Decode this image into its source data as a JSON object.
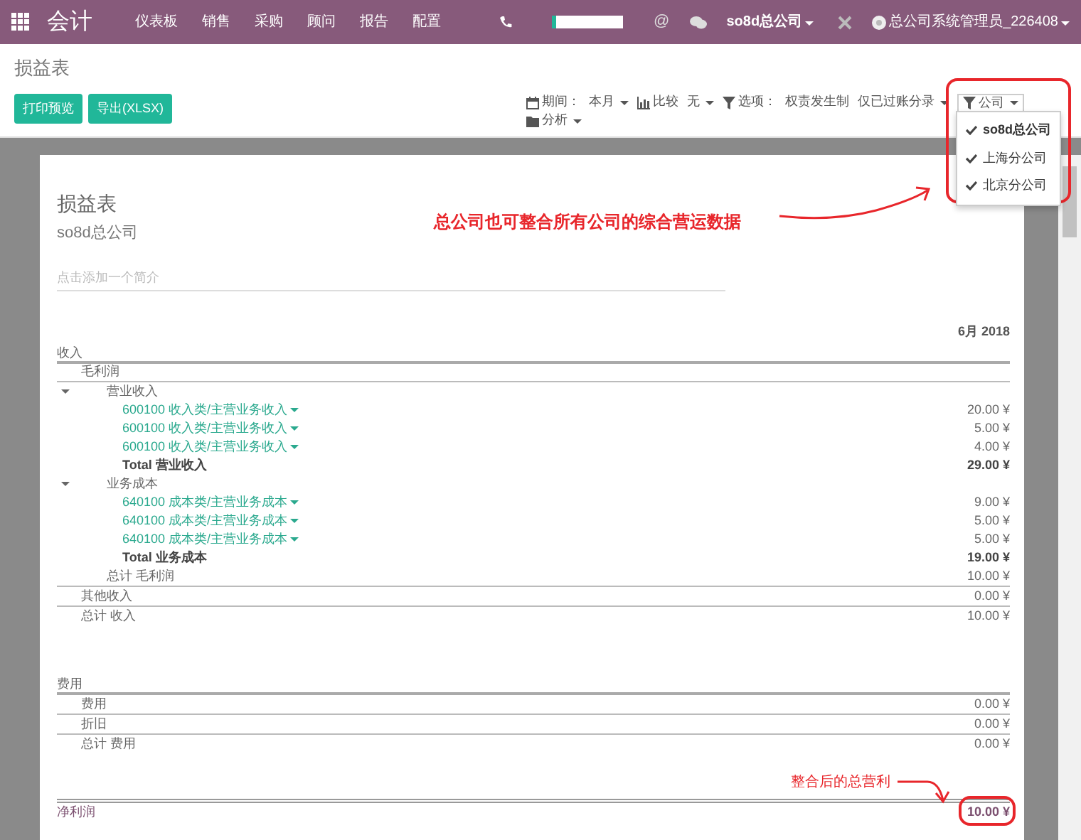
{
  "navbar": {
    "app_title": "会计",
    "menu": [
      "仪表板",
      "销售",
      "采购",
      "顾问",
      "报告",
      "配置"
    ],
    "mention_symbol": "@",
    "company": "so8d总公司",
    "user": "总公司系统管理员_226408"
  },
  "breadcrumb": "损益表",
  "buttons": [
    "打印预览",
    "导出(XLSX)"
  ],
  "filters": [
    {
      "kind": "period",
      "label": "期间：",
      "values": [
        "本月"
      ]
    },
    {
      "kind": "comparison",
      "label": "比较",
      "values": [
        "无"
      ]
    },
    {
      "kind": "options",
      "label": "选项：",
      "values": [
        "权责发生制",
        "仅已过账分录"
      ]
    },
    {
      "kind": "company",
      "label": "公司",
      "expanded": true
    },
    {
      "kind": "analysis",
      "label": "分析"
    }
  ],
  "company_menu": [
    {
      "label": "so8d总公司",
      "checked": true
    },
    {
      "label": "上海分公司",
      "checked": true
    },
    {
      "label": "北京分公司",
      "checked": true
    }
  ],
  "report": {
    "title": "损益表",
    "company": "so8d总公司",
    "summary_placeholder": "点击添加一个简介",
    "column": "6月 2018",
    "sections": [
      {
        "kind": "section",
        "label": "收入",
        "children": [
          {
            "kind": "group",
            "label": "毛利润",
            "children": [
              {
                "kind": "fold",
                "label": "营业收入",
                "expanded": true,
                "children": [
                  {
                    "kind": "account",
                    "label": "600100 收入类/主营业务收入",
                    "amount": "20.00 ¥"
                  },
                  {
                    "kind": "account",
                    "label": "600100 收入类/主营业务收入",
                    "amount": "5.00 ¥"
                  },
                  {
                    "kind": "account",
                    "label": "600100 收入类/主营业务收入",
                    "amount": "4.00 ¥"
                  },
                  {
                    "kind": "total",
                    "label": "Total 营业收入",
                    "amount": "29.00 ¥"
                  }
                ]
              },
              {
                "kind": "fold",
                "label": "业务成本",
                "expanded": true,
                "children": [
                  {
                    "kind": "account",
                    "label": "640100 成本类/主营业务成本",
                    "amount": "9.00 ¥"
                  },
                  {
                    "kind": "account",
                    "label": "640100 成本类/主营业务成本",
                    "amount": "5.00 ¥"
                  },
                  {
                    "kind": "account",
                    "label": "640100 成本类/主营业务成本",
                    "amount": "5.00 ¥"
                  },
                  {
                    "kind": "total",
                    "label": "Total 业务成本",
                    "amount": "19.00 ¥"
                  }
                ]
              },
              {
                "kind": "line",
                "label": "总计 毛利润",
                "amount": "10.00 ¥"
              }
            ]
          },
          {
            "kind": "line",
            "label": "其他收入",
            "amount": "0.00 ¥"
          },
          {
            "kind": "line",
            "label": "总计 收入",
            "amount": "10.00 ¥"
          }
        ]
      },
      {
        "kind": "section",
        "label": "费用",
        "children": [
          {
            "kind": "line",
            "label": "费用",
            "amount": "0.00 ¥"
          },
          {
            "kind": "line",
            "label": "折旧",
            "amount": "0.00 ¥"
          },
          {
            "kind": "line",
            "label": "总计 费用",
            "amount": "0.00 ¥"
          }
        ]
      }
    ],
    "net": {
      "label": "净利润",
      "amount": "10.00 ¥"
    }
  },
  "annotations": {
    "company_note": "总公司也可整合所有公司的综合营运数据",
    "profit_note": "整合后的总营利"
  }
}
